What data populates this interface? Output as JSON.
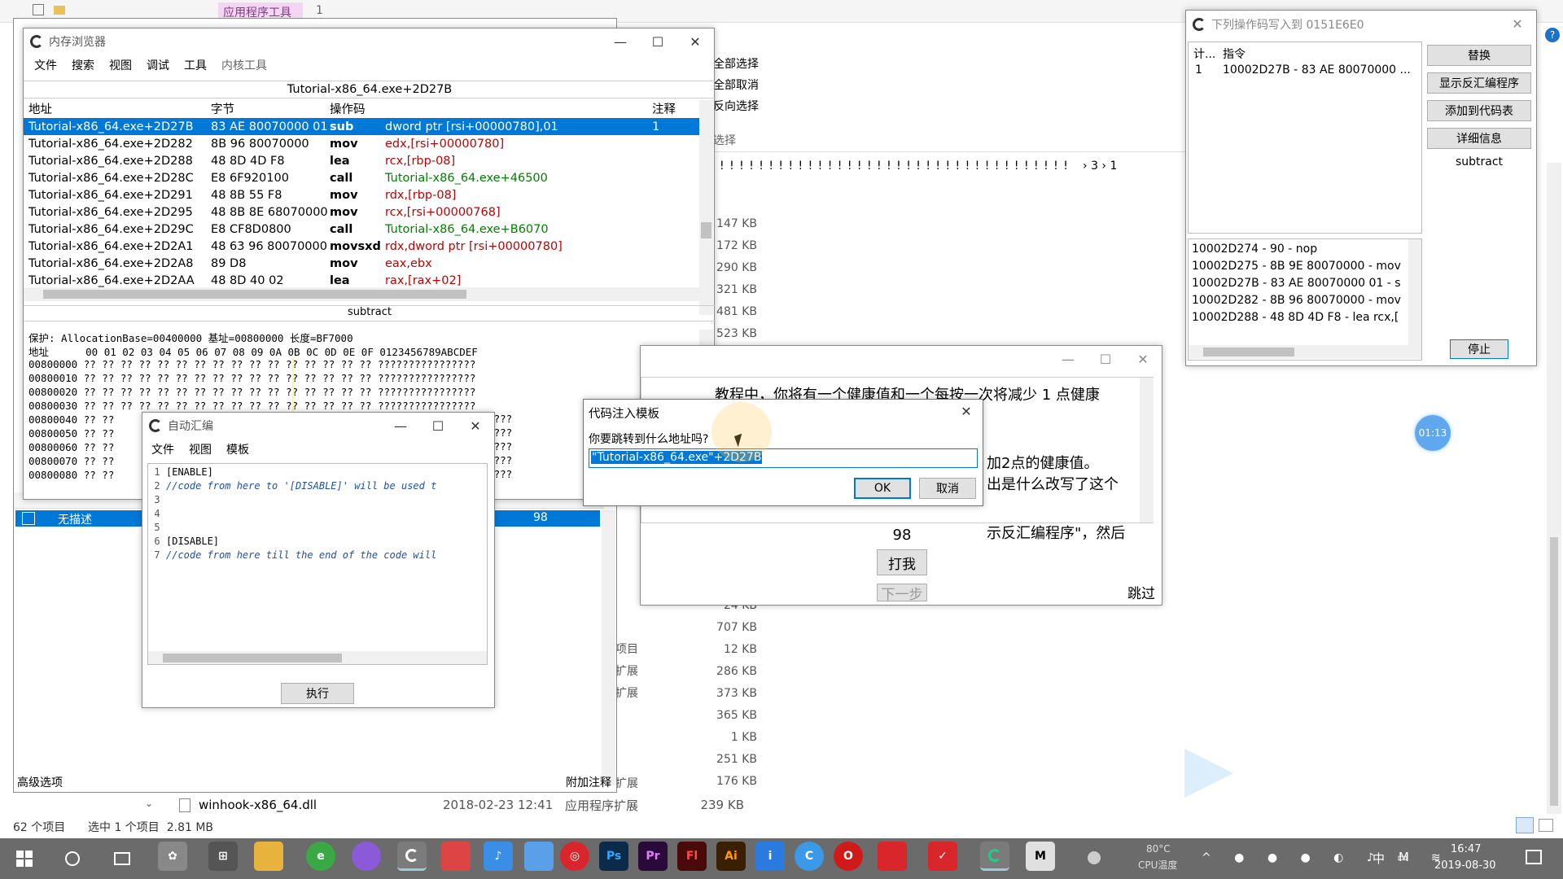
{
  "explorer": {
    "ribbon_tab": "应用程序工具",
    "ribbon_num": "1",
    "ribbon_items": [
      "全部选择",
      "全部取消",
      "反向选择"
    ],
    "ribbon_group": "选择",
    "breadcrumb": "! ! ! ! ! ! ! ! ! ! ! ! ! ! ! ! ! ! ! ! ! ! ! ! ! ! ! ! ! ! ! ! ! ! ! ! ! ! ! ! ! ! ! ! ! ! ! !",
    "crumb_a": "3",
    "crumb_b": "1",
    "sizes": [
      "147 KB",
      "172 KB",
      "290 KB",
      "321 KB",
      "481 KB",
      "523 KB"
    ],
    "sizes2": [
      "24 KB",
      "707 KB",
      "12 KB",
      "286 KB",
      "373 KB",
      "365 KB",
      "1 KB",
      "251 KB",
      "176 KB",
      "239 KB"
    ],
    "types2": [
      "项目",
      "扩展",
      "扩展",
      "扩展"
    ],
    "last_file": "winhook-x86_64.dll",
    "last_date": "2018-02-23 12:41",
    "last_type": "应用程序扩展",
    "last_size": "239 KB",
    "status_count": "62 个项目",
    "status_sel": "选中 1 个项目  2.81 MB"
  },
  "memview": {
    "title": "内存浏览器",
    "menu": [
      "文件",
      "搜索",
      "视图",
      "调试",
      "工具",
      "内核工具"
    ],
    "location": "Tutorial-x86_64.exe+2D27B",
    "headers": [
      "地址",
      "字节",
      "操作码",
      "注释"
    ],
    "rows": [
      {
        "addr": "Tutorial-x86_64.exe+2D27B",
        "bytes": "83 AE 80070000 01",
        "op": "sub",
        "args": "dword ptr [rsi+00000780],01",
        "note": "1"
      },
      {
        "addr": "Tutorial-x86_64.exe+2D282",
        "bytes": "8B 96 80070000",
        "op": "mov",
        "args": "edx,[rsi+00000780]",
        "note": ""
      },
      {
        "addr": "Tutorial-x86_64.exe+2D288",
        "bytes": "48 8D 4D F8",
        "op": "lea",
        "args": "rcx,[rbp-08]",
        "note": ""
      },
      {
        "addr": "Tutorial-x86_64.exe+2D28C",
        "bytes": "E8 6F920100",
        "op": "call",
        "args": "Tutorial-x86_64.exe+46500",
        "note": ""
      },
      {
        "addr": "Tutorial-x86_64.exe+2D291",
        "bytes": "48 8B 55 F8",
        "op": "mov",
        "args": "rdx,[rbp-08]",
        "note": ""
      },
      {
        "addr": "Tutorial-x86_64.exe+2D295",
        "bytes": "48 8B 8E 68070000",
        "op": "mov",
        "args": "rcx,[rsi+00000768]",
        "note": ""
      },
      {
        "addr": "Tutorial-x86_64.exe+2D29C",
        "bytes": "E8 CF8D0800",
        "op": "call",
        "args": "Tutorial-x86_64.exe+B6070",
        "note": ""
      },
      {
        "addr": "Tutorial-x86_64.exe+2D2A1",
        "bytes": "48 63 96 80070000",
        "op": "movsxd",
        "args": "rdx,dword ptr [rsi+00000780]",
        "note": ""
      },
      {
        "addr": "Tutorial-x86_64.exe+2D2A8",
        "bytes": "89 D8",
        "op": "mov",
        "args": "eax,ebx",
        "note": ""
      },
      {
        "addr": "Tutorial-x86_64.exe+2D2AA",
        "bytes": "48 8D 40 02",
        "op": "lea",
        "args": "rax,[rax+02]",
        "note": ""
      }
    ],
    "comment_bar": "subtract",
    "hex_info": "保护: AllocationBase=00400000 基址=00800000 长度=BF7000",
    "hex_header": "地址      00 01 02 03 04 05 06 07 08 09 0A 0B 0C 0D 0E 0F 0123456789ABCDEF",
    "hex_rows": [
      "00800000 ?? ?? ?? ?? ?? ?? ?? ?? ?? ?? ?? ?? ?? ?? ?? ?? ????????????????",
      "00800010 ?? ?? ?? ?? ?? ?? ?? ?? ?? ?? ?? ?? ?? ?? ?? ?? ????????????????",
      "00800020 ?? ?? ?? ?? ?? ?? ?? ?? ?? ?? ?? ?? ?? ?? ?? ?? ????????????????",
      "00800030 ?? ?? ?? ?? ?? ?? ?? ?? ?? ?? ?? ?? ?? ?? ?? ?? ????????????????",
      "00800040 ?? ??",
      "00800050 ?? ??",
      "00800060 ?? ??",
      "00800070 ?? ??",
      "00800080 ?? ??"
    ],
    "hex_tail": [
      "????????",
      "????????",
      "????????",
      "????????",
      "????????"
    ]
  },
  "ct_main": {
    "list_desc": "无描述",
    "list_value": "98",
    "bottom_left": "高级选项",
    "bottom_right": "附加注释"
  },
  "autoasm": {
    "title": "自动汇编",
    "menu": [
      "文件",
      "视图",
      "模板"
    ],
    "lines": [
      "[ENABLE]",
      "//code from here to '[DISABLE]' will be used t",
      "",
      "",
      "",
      "[DISABLE]",
      "//code from here till the end of the code will"
    ],
    "execute": "执行"
  },
  "dialog": {
    "title": "代码注入模板",
    "prompt": "你要跳转到什么地址吗?",
    "value": "\"Tutorial-x86_64.exe\"+2D27B",
    "ok": "OK",
    "cancel": "取消"
  },
  "tutorial": {
    "text": [
      "教程中，你将有一个健康值和一个每按一次将减少 1 点健康",
      "加2点的健康值。",
      "出是什么改写了这个",
      "示反汇编程序\"，然后"
    ],
    "health": "98",
    "hit": "打我",
    "next": "下一步",
    "skip": "跳过"
  },
  "opwriter": {
    "title": "下列操作码写入到 0151E6E0",
    "headers": [
      "计...",
      "指令"
    ],
    "row_count": "1",
    "row_instr": "10002D27B - 83 AE 80070000 ...",
    "buttons": [
      "替换",
      "显示反汇编程序",
      "添加到代码表",
      "详细信息"
    ],
    "comment": "subtract",
    "asm": [
      "10002D274 - 90 - nop",
      "10002D275 - 8B 9E 80070000 - mov",
      "10002D27B - 83 AE 80070000 01 - s",
      "10002D282 - 8B 96 80070000  - mov",
      "10002D288 - 48 8D 4D F8  - lea rcx,["
    ],
    "stop": "停止"
  },
  "timer": "01:13",
  "taskbar": {
    "temp": "80°C",
    "temp_label": "CPU温度",
    "ime": "中",
    "time": "16:47",
    "date": "2019-08-30",
    "icons": [
      "Ps",
      "Pr",
      "Fl",
      "Ai",
      "M"
    ]
  },
  "colors": {
    "select": "#0078d7",
    "green": "#008000",
    "red": "#c00000",
    "accent": "#0078d7"
  }
}
